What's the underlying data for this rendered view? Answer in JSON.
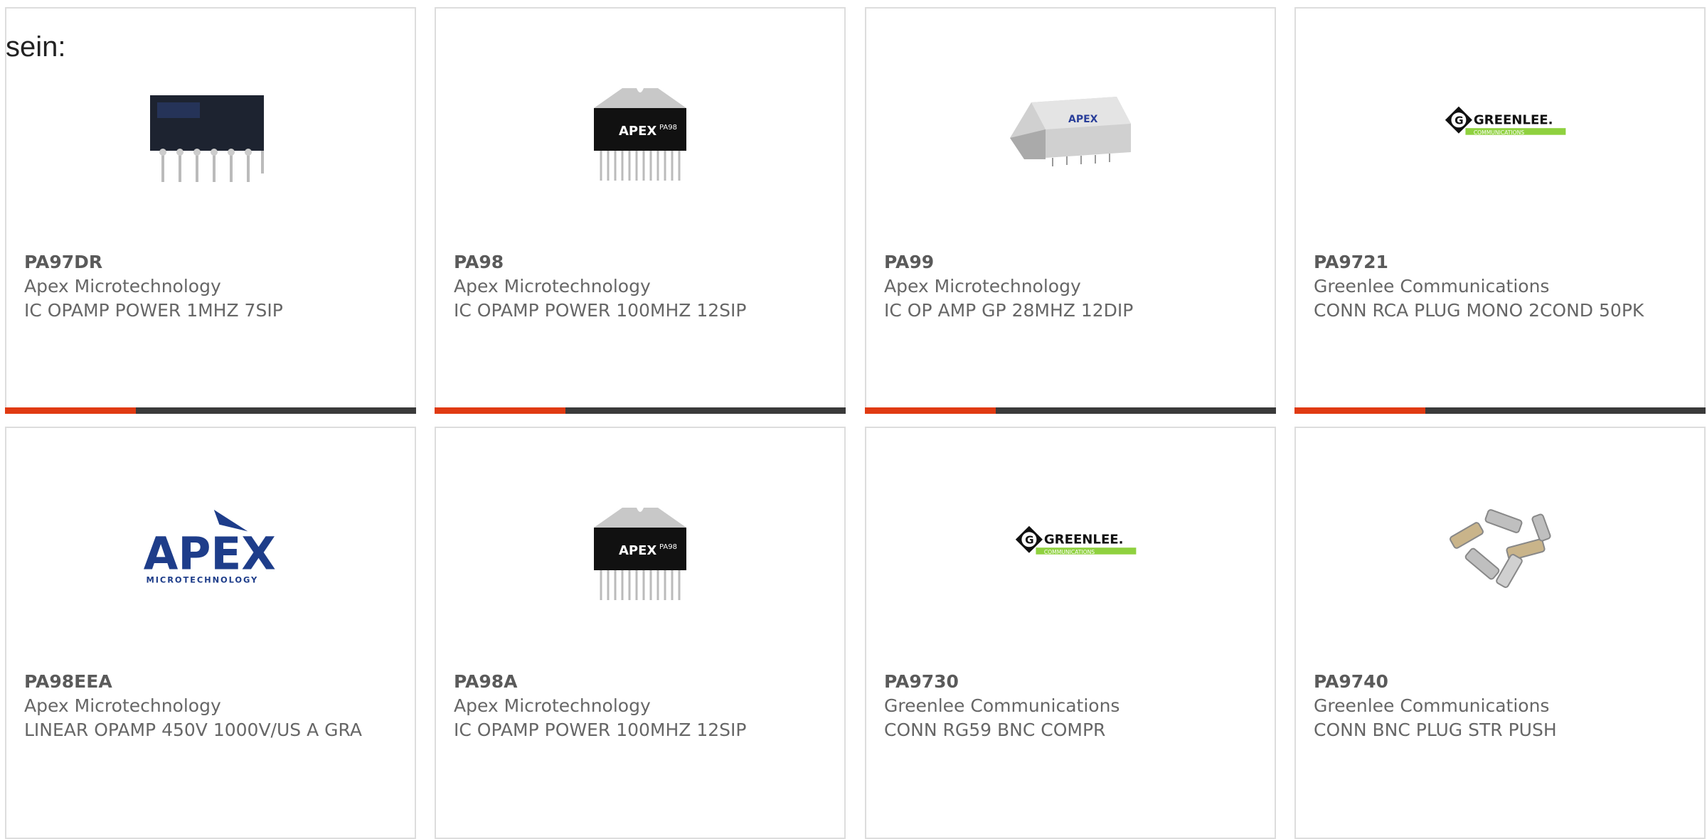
{
  "lead_text": "sein:",
  "colors": {
    "accent": "#e03a12",
    "bar_dark": "#3a3a3a",
    "text": "#666666",
    "border": "#dddddd"
  },
  "products": [
    {
      "part_number": "PA97DR",
      "manufacturer": "Apex Microtechnology",
      "description": "IC OPAMP POWER 1MHZ 7SIP",
      "image": "sip-7-chip-image"
    },
    {
      "part_number": "PA98",
      "manufacturer": "Apex Microtechnology",
      "description": "IC OPAMP POWER 100MHZ 12SIP",
      "image": "sip-12-chip-image",
      "chip_label": "APEX",
      "chip_model": "PA98"
    },
    {
      "part_number": "PA99",
      "manufacturer": "Apex Microtechnology",
      "description": "IC OP AMP GP 28MHZ 12DIP",
      "image": "dip-module-image",
      "chip_label": "APEX"
    },
    {
      "part_number": "PA9721",
      "manufacturer": "Greenlee Communications",
      "description": "CONN RCA PLUG MONO 2COND 50PK",
      "image": "greenlee-logo",
      "logo_text": "GREENLEE.",
      "logo_subtext": "COMMUNICATIONS"
    },
    {
      "part_number": "PA98EEA",
      "manufacturer": "Apex Microtechnology",
      "description": "LINEAR OPAMP 450V 1000V/US A GRA",
      "image": "apex-logo",
      "logo_text": "APEX",
      "logo_subtext": "MICROTECHNOLOGY"
    },
    {
      "part_number": "PA98A",
      "manufacturer": "Apex Microtechnology",
      "description": "IC OPAMP POWER 100MHZ 12SIP",
      "image": "sip-12-chip-image",
      "chip_label": "APEX",
      "chip_model": "PA98"
    },
    {
      "part_number": "PA9730",
      "manufacturer": "Greenlee Communications",
      "description": "CONN RG59 BNC COMPR",
      "image": "greenlee-logo",
      "logo_text": "GREENLEE.",
      "logo_subtext": "COMMUNICATIONS"
    },
    {
      "part_number": "PA9740",
      "manufacturer": "Greenlee Communications",
      "description": "CONN BNC PLUG STR PUSH",
      "image": "bnc-connectors-image"
    }
  ]
}
